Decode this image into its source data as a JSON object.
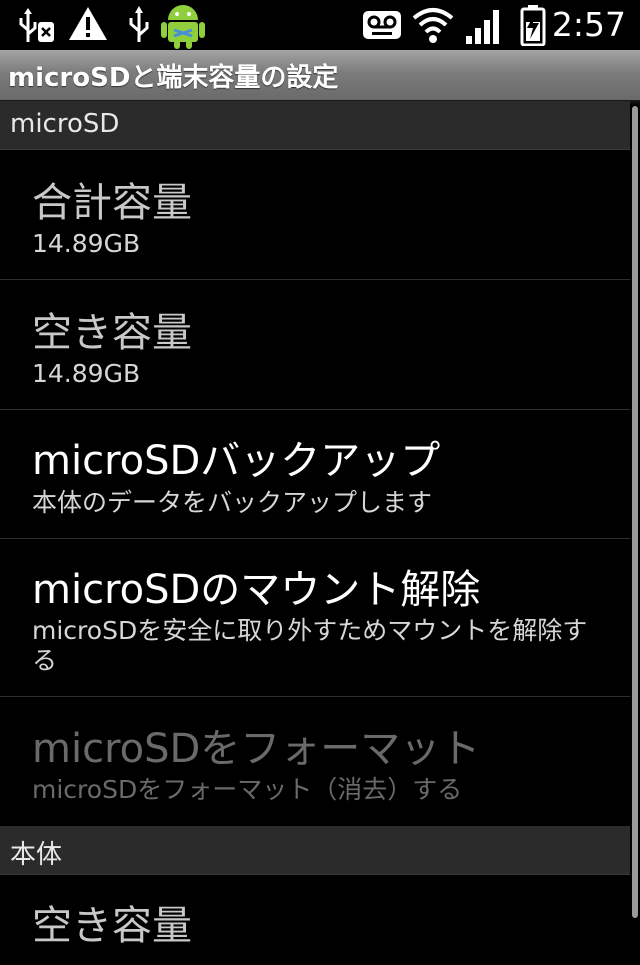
{
  "status_bar": {
    "time": "2:57",
    "icons": [
      "usb-debug-icon",
      "warning-icon",
      "usb-icon",
      "android-icon",
      "voicemail-icon",
      "wifi-icon",
      "signal-icon",
      "battery-charging-icon"
    ]
  },
  "app": {
    "title": "microSDと端末容量の設定"
  },
  "sections": {
    "microsd": {
      "header": "microSD",
      "total": {
        "title": "合計容量",
        "value": "14.89GB"
      },
      "free": {
        "title": "空き容量",
        "value": "14.89GB"
      },
      "backup": {
        "title": "microSDバックアップ",
        "summary": "本体のデータをバックアップします"
      },
      "unmount": {
        "title": "microSDのマウント解除",
        "summary": "microSDを安全に取り外すためマウントを解除する"
      },
      "format": {
        "title": "microSDをフォーマット",
        "summary": "microSDをフォーマット（消去）する"
      }
    },
    "internal": {
      "header": "本体",
      "free": {
        "title": "空き容量"
      }
    }
  },
  "colors": {
    "background": "#000000",
    "titlebar": "#8a8a8a",
    "section_header": "#2b2b2b",
    "disabled_text": "#6a6a6a"
  }
}
